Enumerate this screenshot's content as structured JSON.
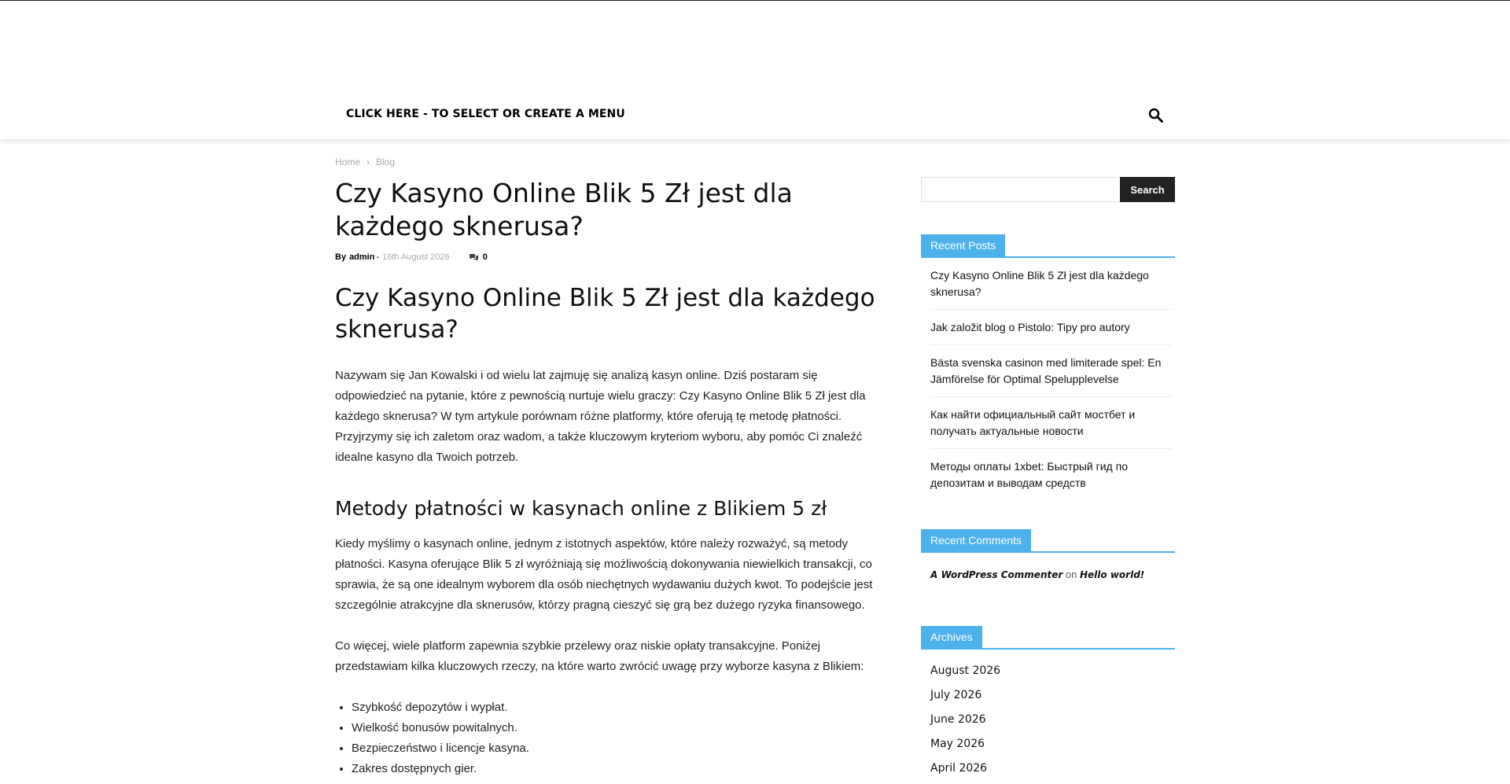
{
  "nav": {
    "menu_label": "CLICK HERE - TO SELECT OR CREATE A MENU",
    "search_icon": "search-icon"
  },
  "breadcrumbs": {
    "home": "Home",
    "separator": "›",
    "current": "Blog"
  },
  "post": {
    "title": "Czy Kasyno Online Blik 5 Zł jest dla każdego sknerusa?",
    "meta": {
      "by_label": "By",
      "author": "admin",
      "dash": "-",
      "date": "16th August 2026",
      "comments": "0",
      "comments_icon": "comments-icon"
    },
    "content": {
      "h1": "Czy Kasyno Online Blik 5 Zł jest dla każdego sknerusa?",
      "p1": "Nazywam się Jan Kowalski i od wielu lat zajmuję się analizą kasyn online. Dziś postaram się odpowiedzieć na pytanie, które z pewnością nurtuje wielu graczy: Czy Kasyno Online Blik 5 Zł jest dla każdego sknerusa? W tym artykule porównam różne platformy, które oferują tę metodę płatności. Przyjrzymy się ich zaletom oraz wadom, a także kluczowym kryteriom wyboru, aby pomóc Ci znaleźć idealne kasyno dla Twoich potrzeb.",
      "h2": "Metody płatności w kasynach online z Blikiem 5 zł",
      "p2": "Kiedy myślimy o kasynach online, jednym z istotnych aspektów, które należy rozważyć, są metody płatności. Kasyna oferujące Blik 5 zł wyróżniają się możliwością dokonywania niewielkich transakcji, co sprawia, że są one idealnym wyborem dla osób niechętnych wydawaniu dużych kwot. To podejście jest szczególnie atrakcyjne dla sknerusów, którzy pragną cieszyć się grą bez dużego ryzyka finansowego.",
      "p3": "Co więcej, wiele platform zapewnia szybkie przelewy oraz niskie opłaty transakcyjne. Poniżej przedstawiam kilka kluczowych rzeczy, na które warto zwrócić uwagę przy wyborze kasyna z Blikiem:",
      "list": [
        "Szybkość depozytów i wypłat.",
        "Wielkość bonusów powitalnych.",
        "Bezpieczeństwo i licencje kasyna.",
        "Zakres dostępnych gier."
      ]
    }
  },
  "sidebar": {
    "search_button": "Search",
    "search_placeholder": "",
    "recent_posts": {
      "title": "Recent Posts",
      "items": [
        "Czy Kasyno Online Blik 5 Zł jest dla każdego sknerusa?",
        "Jak založit blog o Pistolo: Tipy pro autory",
        "Bästa svenska casinon med limiterade spel: En Jämförelse för Optimal Spelupplevelse",
        "Как найти официальный сайт мостбет и получать актуальные новости",
        "Методы оплаты 1xbet: Быстрый гид по депозитам и выводам средств"
      ]
    },
    "recent_comments": {
      "title": "Recent Comments",
      "author": "A WordPress Commenter",
      "on": "on",
      "post": "Hello world!"
    },
    "archives": {
      "title": "Archives",
      "items": [
        "August 2026",
        "July 2026",
        "June 2026",
        "May 2026",
        "April 2026"
      ]
    }
  },
  "colors": {
    "accent": "#4db2ec",
    "button_dark": "#222222",
    "meta_gray": "#aaaaaa"
  }
}
